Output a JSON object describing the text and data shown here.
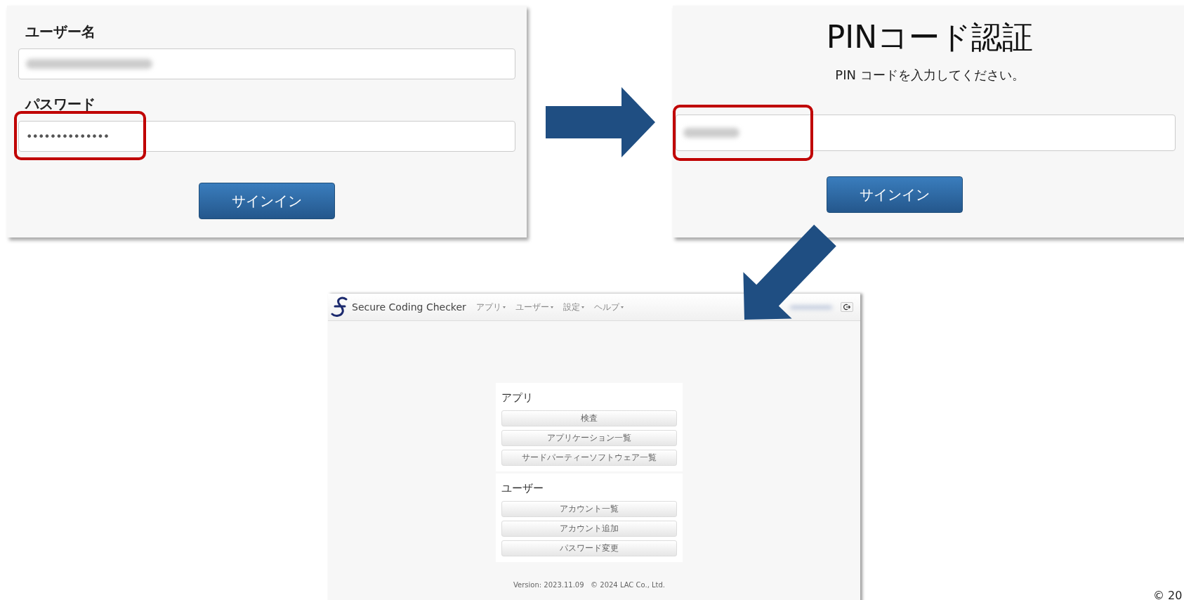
{
  "login_panel": {
    "fields": [
      {
        "label": "ユーザー名",
        "kind": "blurred",
        "highlighted": false
      },
      {
        "label": "パスワード",
        "kind": "password",
        "value": "••••••••••••••",
        "highlighted": true
      }
    ],
    "button": "サインイン"
  },
  "pin_panel": {
    "title": "PINコード認証",
    "instruction": "PIN コードを入力してください。",
    "field": {
      "kind": "blurred",
      "highlighted": true
    },
    "button": "サインイン"
  },
  "app": {
    "brand": "Secure Coding Checker",
    "nav": [
      "アプリ",
      "ユーザー",
      "設定",
      "ヘルプ"
    ],
    "sections": [
      {
        "title": "アプリ",
        "buttons": [
          "検査",
          "アプリケーション一覧",
          "サードパーティーソフトウェア一覧"
        ]
      },
      {
        "title": "ユーザー",
        "buttons": [
          "アカウント一覧",
          "アカウント追加",
          "パスワード変更"
        ]
      }
    ],
    "footer": "Version: 2023.11.09   © 2024 LAC Co., Ltd."
  },
  "corner_text": "© 20"
}
